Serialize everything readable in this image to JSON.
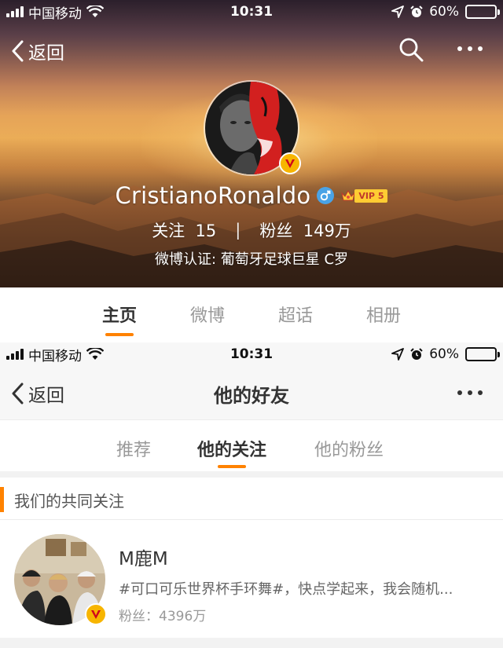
{
  "status_bar_top": {
    "carrier": "中国移动",
    "time": "10:31",
    "battery": "60%",
    "battery_level": 0.6
  },
  "profile": {
    "back_label": "返回",
    "username": "CristianoRonaldo",
    "vip_label": "VIP 5",
    "stats": {
      "following_label": "关注",
      "following_count": "15",
      "separator": "|",
      "fans_label": "粉丝",
      "fans_count": "149万"
    },
    "verification": "微博认证: 葡萄牙足球巨星  C罗",
    "tabs": [
      {
        "label": "主页",
        "active": true
      },
      {
        "label": "微博",
        "active": false
      },
      {
        "label": "超话",
        "active": false
      },
      {
        "label": "相册",
        "active": false
      }
    ]
  },
  "status_bar_bottom": {
    "carrier": "中国移动",
    "time": "10:31",
    "battery": "60%",
    "battery_level": 0.6
  },
  "friends_page": {
    "back_label": "返回",
    "title": "他的好友",
    "tabs": [
      {
        "label": "推荐",
        "active": false
      },
      {
        "label": "他的关注",
        "active": true
      },
      {
        "label": "他的粉丝",
        "active": false
      }
    ],
    "section_title": "我们的共同关注",
    "items": [
      {
        "name": "M鹿M",
        "description": "#可口可乐世界杯手环舞#，快点学起来，我会随机...",
        "fans": "粉丝：4396万"
      }
    ]
  },
  "colors": {
    "accent": "#ff8200",
    "verified_badge": "#f7b500",
    "gender_male": "#4aa3e6",
    "vip_gold": "#ffcc33"
  },
  "icons": [
    "signal-icon",
    "wifi-icon",
    "location-arrow-icon",
    "alarm-icon",
    "battery-icon",
    "back-chevron-icon",
    "search-icon",
    "more-dots-icon",
    "verified-v-icon",
    "male-gender-icon",
    "vip-crown-icon"
  ]
}
